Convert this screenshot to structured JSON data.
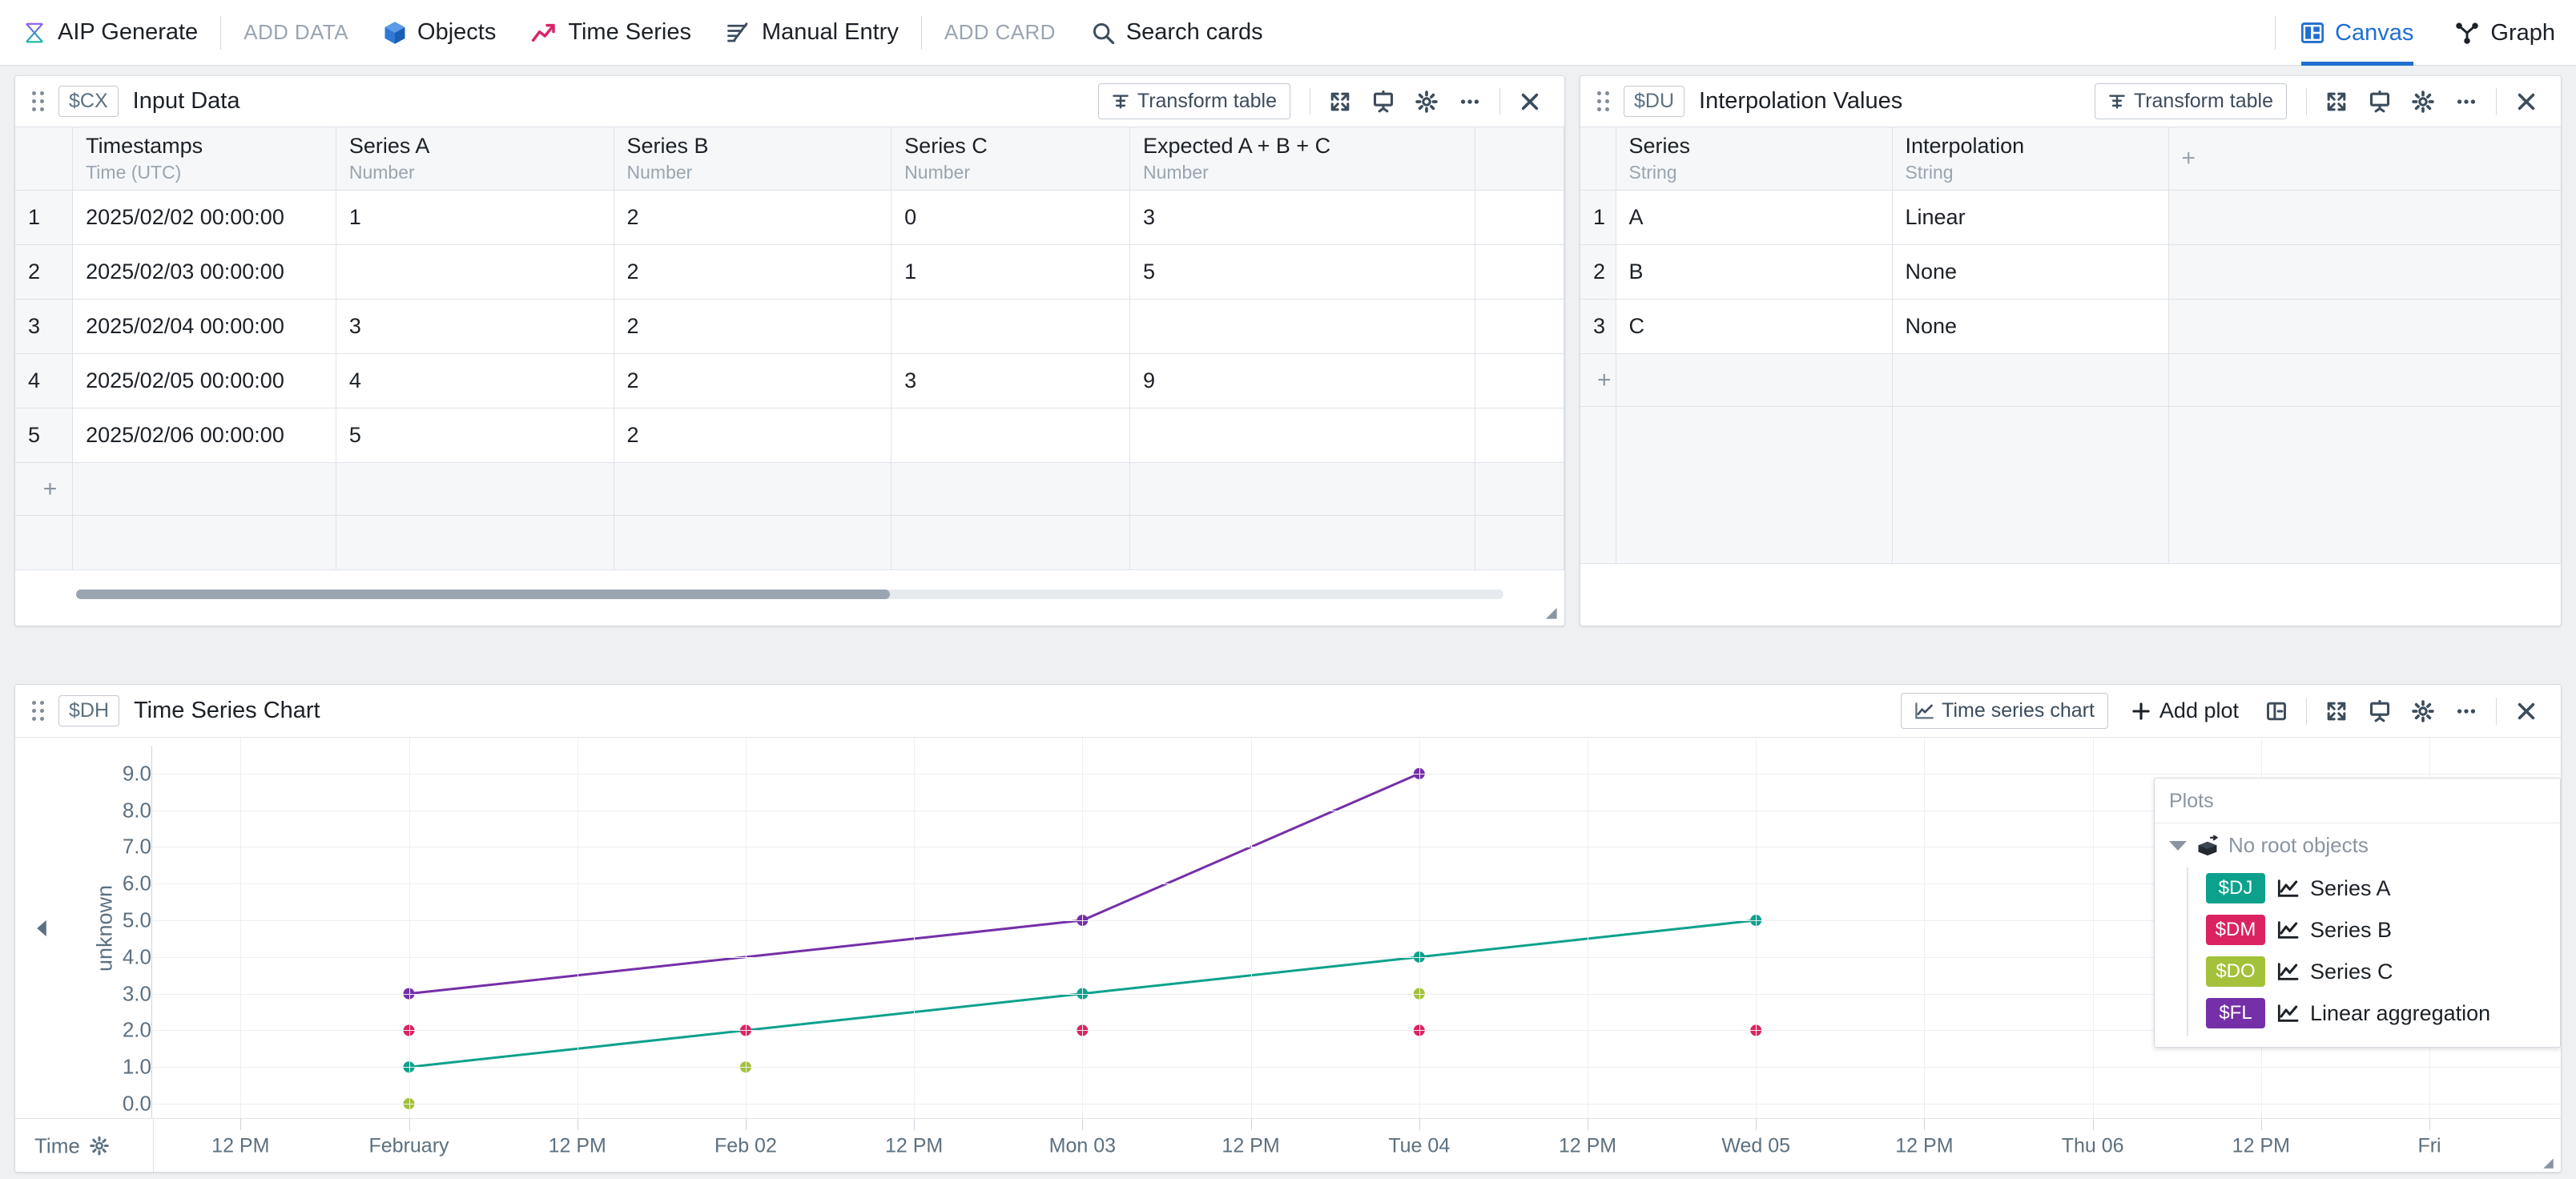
{
  "topbar": {
    "left_items": [
      {
        "label": "AIP Generate",
        "icon": "aip-generate-icon",
        "muted": false
      },
      {
        "label": "ADD DATA",
        "icon": "",
        "muted": true
      },
      {
        "label": "Objects",
        "icon": "objects-cube-icon",
        "muted": false
      },
      {
        "label": "Time Series",
        "icon": "time-series-icon",
        "muted": false
      },
      {
        "label": "Manual Entry",
        "icon": "manual-entry-icon",
        "muted": false
      },
      {
        "label": "ADD CARD",
        "icon": "",
        "muted": true
      },
      {
        "label": "Search cards",
        "icon": "search-icon",
        "muted": false
      }
    ],
    "right_tabs": [
      {
        "label": "Canvas",
        "icon": "canvas-layout-icon",
        "active": true
      },
      {
        "label": "Graph",
        "icon": "graph-node-icon",
        "active": false
      }
    ],
    "accent_color": "#1f6fd0"
  },
  "input_data_card": {
    "ref": "$CX",
    "title": "Input Data",
    "transform_label": "Transform table",
    "columns": [
      {
        "name": "Timestamps",
        "type": "Time (UTC)"
      },
      {
        "name": "Series A",
        "type": "Number"
      },
      {
        "name": "Series B",
        "type": "Number"
      },
      {
        "name": "Series C",
        "type": "Number"
      },
      {
        "name": "Expected A + B + C",
        "type": "Number"
      }
    ],
    "rows": [
      {
        "n": "1",
        "cells": [
          "2025/02/02 00:00:00",
          "1",
          "2",
          "0",
          "3"
        ]
      },
      {
        "n": "2",
        "cells": [
          "2025/02/03 00:00:00",
          "",
          "2",
          "1",
          "5"
        ]
      },
      {
        "n": "3",
        "cells": [
          "2025/02/04 00:00:00",
          "3",
          "2",
          "",
          ""
        ]
      },
      {
        "n": "4",
        "cells": [
          "2025/02/05 00:00:00",
          "4",
          "2",
          "3",
          "9"
        ]
      },
      {
        "n": "5",
        "cells": [
          "2025/02/06 00:00:00",
          "5",
          "2",
          "",
          ""
        ]
      }
    ],
    "add_row_symbol": "+"
  },
  "interpolation_card": {
    "ref": "$DU",
    "title": "Interpolation Values",
    "transform_label": "Transform table",
    "add_column_symbol": "+",
    "columns": [
      {
        "name": "Series",
        "type": "String"
      },
      {
        "name": "Interpolation",
        "type": "String"
      }
    ],
    "rows": [
      {
        "n": "1",
        "cells": [
          "A",
          "Linear"
        ]
      },
      {
        "n": "2",
        "cells": [
          "B",
          "None"
        ]
      },
      {
        "n": "3",
        "cells": [
          "C",
          "None"
        ]
      }
    ],
    "add_row_symbol": "+"
  },
  "chart_card": {
    "ref": "$DH",
    "title": "Time Series Chart",
    "type_label": "Time series chart",
    "add_plot_label": "Add plot",
    "plots_panel": {
      "header": "Plots",
      "root_label": "No root objects",
      "items": [
        {
          "ref": "$DJ",
          "label": "Series A",
          "color": "#0CA18C"
        },
        {
          "ref": "$DM",
          "label": "Series B",
          "color": "#DB2362"
        },
        {
          "ref": "$DO",
          "label": "Series C",
          "color": "#A4C13B"
        },
        {
          "ref": "$FL",
          "label": "Linear aggregation",
          "color": "#752FA8"
        }
      ]
    }
  },
  "chart_data": {
    "type": "scatter",
    "title": "Time Series Chart",
    "xlabel": "Time",
    "ylabel": "unknown",
    "ylim": [
      0.0,
      9.5
    ],
    "yticks": [
      "0.0",
      "1.0",
      "2.0",
      "3.0",
      "4.0",
      "5.0",
      "6.0",
      "7.0",
      "8.0",
      "9.0"
    ],
    "xticks": [
      "12 PM",
      "February",
      "12 PM",
      "Feb 02",
      "12 PM",
      "Mon 03",
      "12 PM",
      "Tue 04",
      "12 PM",
      "Wed 05",
      "12 PM",
      "Thu 06",
      "12 PM",
      "Fri"
    ],
    "grid": true,
    "legend_position": "right-panel",
    "series": [
      {
        "name": "Series A",
        "color": "#0CA18C",
        "mode": "lines+markers",
        "x": [
          "2025/02/02 00:00:00",
          "2025/02/03 00:00:00",
          "2025/02/04 00:00:00",
          "2025/02/05 00:00:00",
          "2025/02/06 00:00:00"
        ],
        "y": [
          1,
          null,
          3,
          4,
          5
        ],
        "interpolation": "Linear"
      },
      {
        "name": "Series B",
        "color": "#DB2362",
        "mode": "markers",
        "x": [
          "2025/02/02 00:00:00",
          "2025/02/03 00:00:00",
          "2025/02/04 00:00:00",
          "2025/02/05 00:00:00",
          "2025/02/06 00:00:00"
        ],
        "y": [
          2,
          2,
          2,
          2,
          2
        ],
        "interpolation": "None"
      },
      {
        "name": "Series C",
        "color": "#A4C13B",
        "mode": "markers",
        "x": [
          "2025/02/02 00:00:00",
          "2025/02/03 00:00:00",
          "2025/02/05 00:00:00"
        ],
        "y": [
          0,
          1,
          3
        ],
        "interpolation": "None"
      },
      {
        "name": "Linear aggregation",
        "color": "#752FA8",
        "mode": "lines+markers",
        "x": [
          "2025/02/02 00:00:00",
          "2025/02/04 00:00:00",
          "2025/02/05 00:00:00"
        ],
        "y": [
          3,
          5,
          9
        ],
        "interpolation": "Linear"
      }
    ]
  }
}
